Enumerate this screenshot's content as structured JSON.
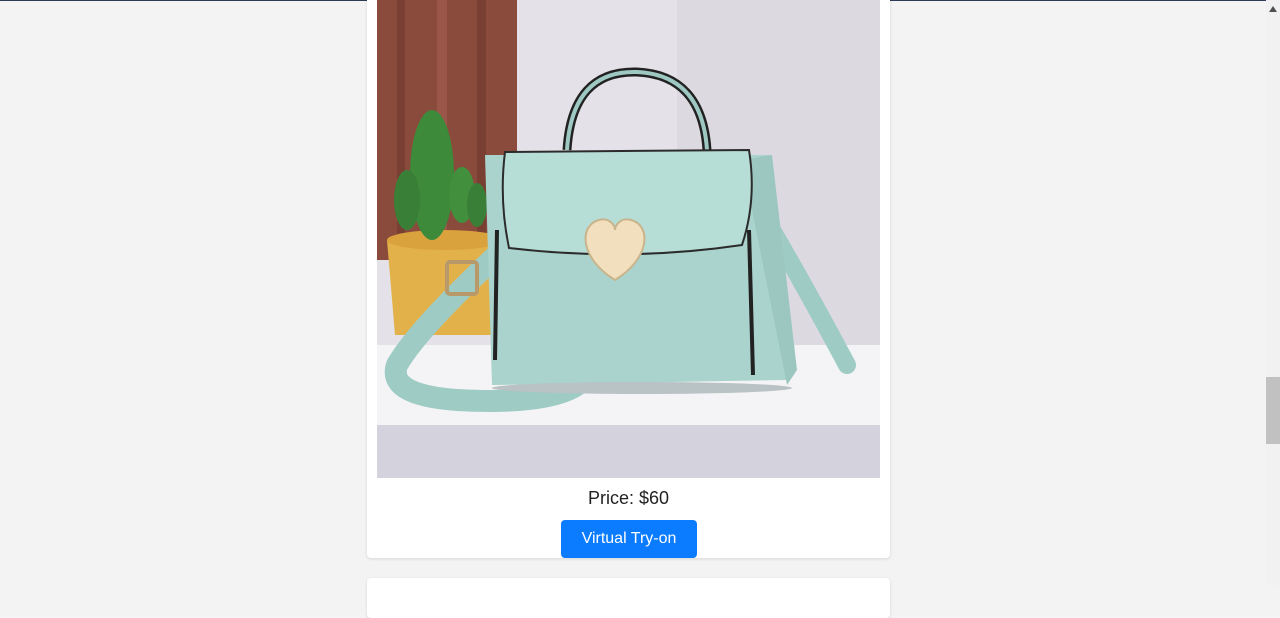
{
  "product": {
    "image_alt": "Mint green leather handbag with heart-shaped clasp",
    "price_label": "Price: ",
    "price_value": "$60",
    "tryon_label": "Virtual Try-on"
  },
  "colors": {
    "background": "#f3f3f3",
    "button": "#0b7cff",
    "bag": "#a9d3cc"
  }
}
